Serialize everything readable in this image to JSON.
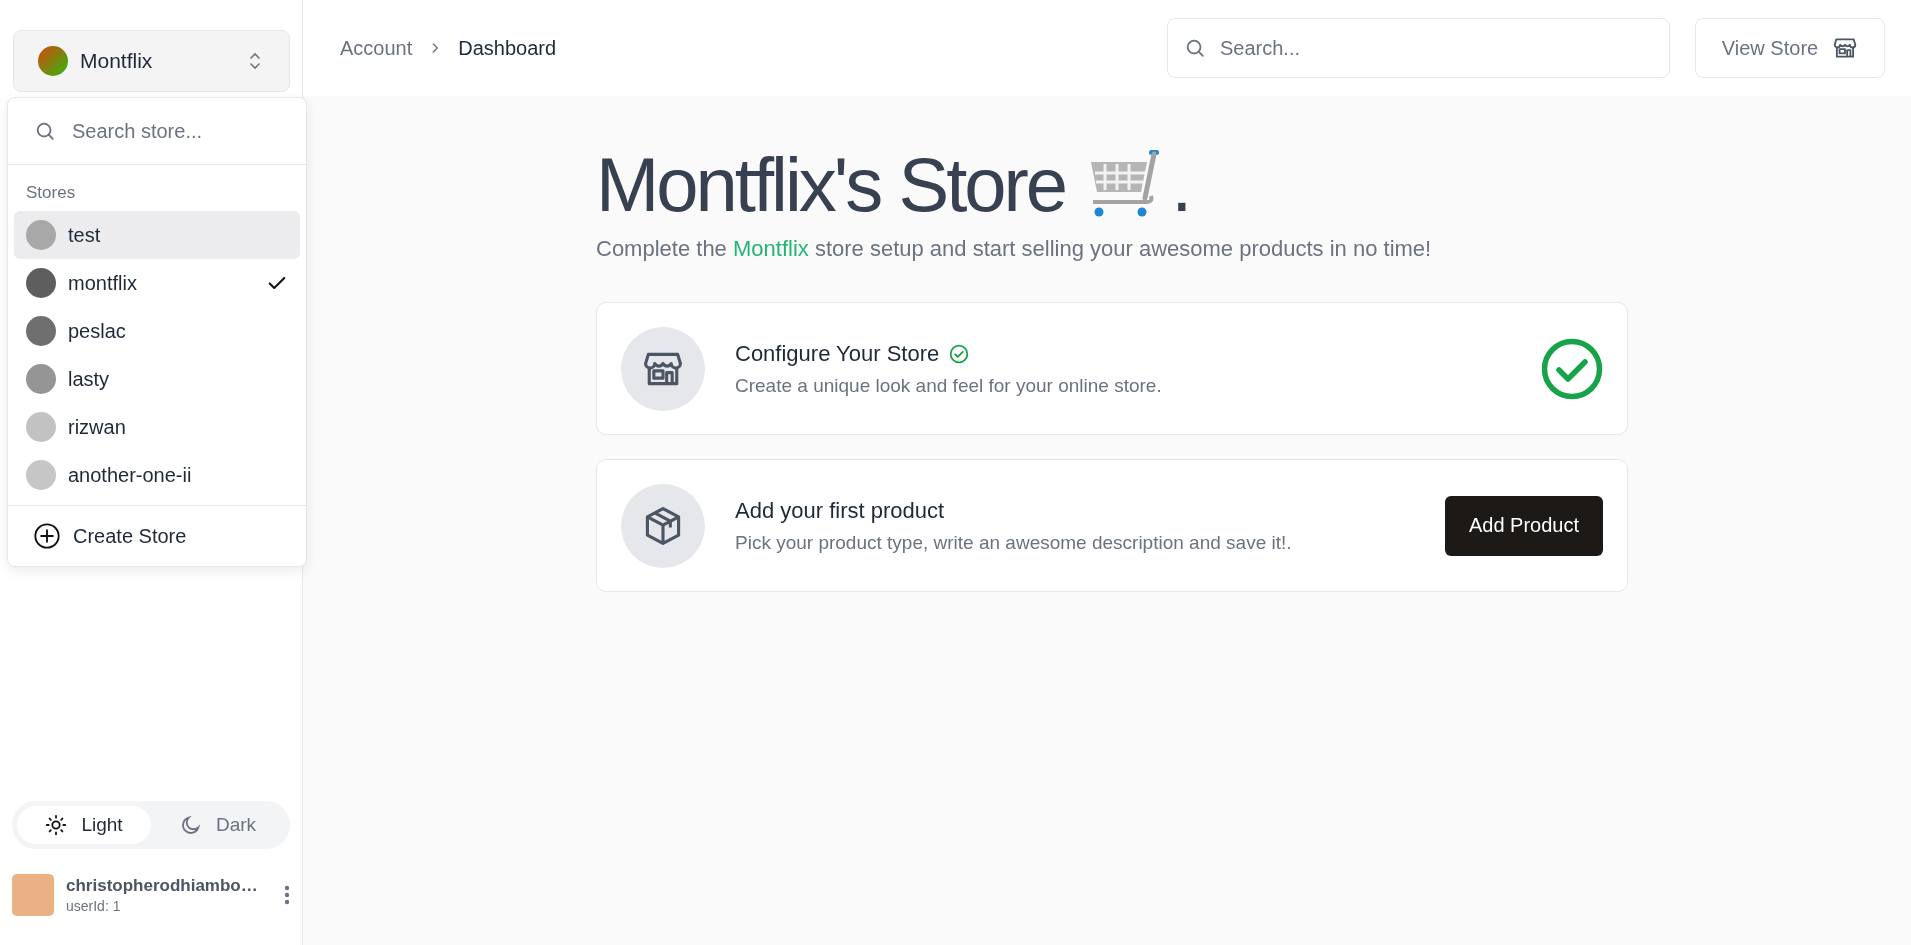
{
  "store_switcher": {
    "name": "Montflix"
  },
  "store_menu": {
    "search_placeholder": "Search store...",
    "section_label": "Stores",
    "stores": [
      {
        "name": "test",
        "selected": false,
        "hovered": true,
        "color": "#a8a8a8"
      },
      {
        "name": "montflix",
        "selected": true,
        "hovered": false,
        "color": "#5e5e5e"
      },
      {
        "name": "peslac",
        "selected": false,
        "hovered": false,
        "color": "#6f6f6f"
      },
      {
        "name": "lasty",
        "selected": false,
        "hovered": false,
        "color": "#959595"
      },
      {
        "name": "rizwan",
        "selected": false,
        "hovered": false,
        "color": "#c2c2c2"
      },
      {
        "name": "another-one-ii",
        "selected": false,
        "hovered": false,
        "color": "#c6c6c6"
      }
    ],
    "create_label": "Create Store"
  },
  "theme_toggle": [
    {
      "label": "Light",
      "kind": "sun",
      "selected": true
    },
    {
      "label": "Dark",
      "kind": "moon",
      "selected": false
    }
  ],
  "user": {
    "name": "christopherodhiambo…",
    "subtitle": "userId: 1"
  },
  "header": {
    "breadcrumbs": [
      "Account",
      "Dashboard"
    ],
    "search_placeholder": "Search...",
    "view_store": "View Store"
  },
  "main": {
    "title": "Montflix's Store",
    "title_suffix": ".",
    "subtitle": [
      {
        "text": "Complete the ",
        "kind": "plain"
      },
      {
        "text": "Montflix",
        "kind": "accent"
      },
      {
        "text": " store setup and start selling your awesome products in no time!",
        "kind": "plain"
      }
    ],
    "steps": [
      {
        "kind": "store",
        "title": "Configure Your Store",
        "description": "Create a unique look and feel for your online store.",
        "completed": true
      },
      {
        "kind": "box",
        "title": "Add your first product",
        "description": "Pick your product type, write an awesome description and save it!.",
        "completed": false,
        "action": "Add Product"
      }
    ]
  }
}
